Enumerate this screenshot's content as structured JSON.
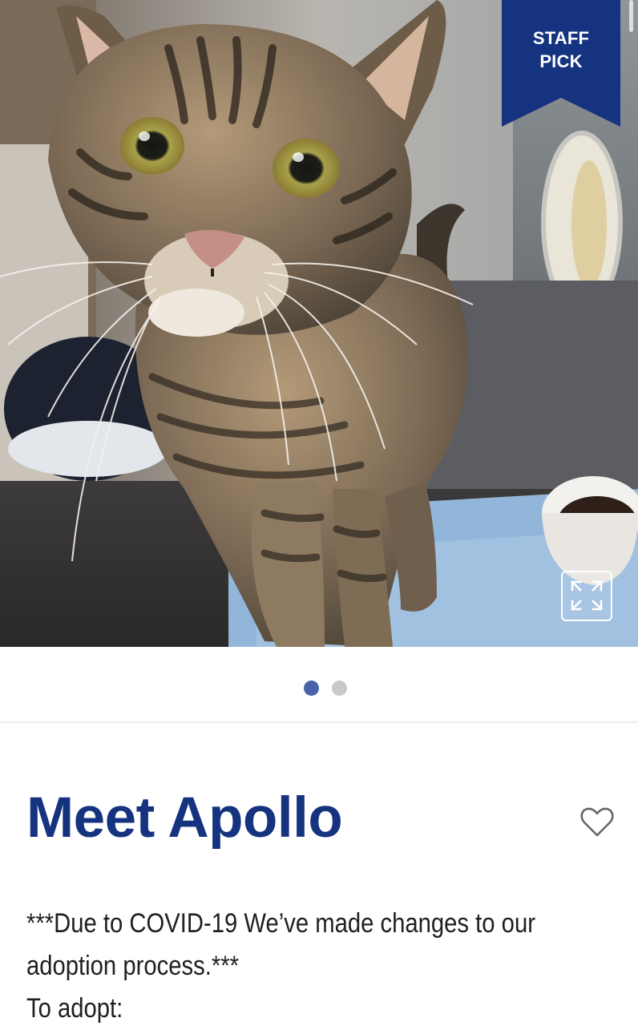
{
  "hero": {
    "badge": {
      "text": "STAFF\nPICK",
      "color": "#16337f"
    },
    "expand_icon": "expand-icon",
    "carousel": {
      "slides": 2,
      "active": 0
    }
  },
  "pet": {
    "title": "Meet Apollo",
    "favorite_icon": "heart-outline-icon"
  },
  "description": {
    "line1": "***Due to COVID-19 We’ve made changes to our adoption process.***",
    "line2": "To adopt:"
  },
  "colors": {
    "brand_navy": "#16337f",
    "dot_active": "#4a63a8",
    "dot_inactive": "#c9c9c9"
  }
}
